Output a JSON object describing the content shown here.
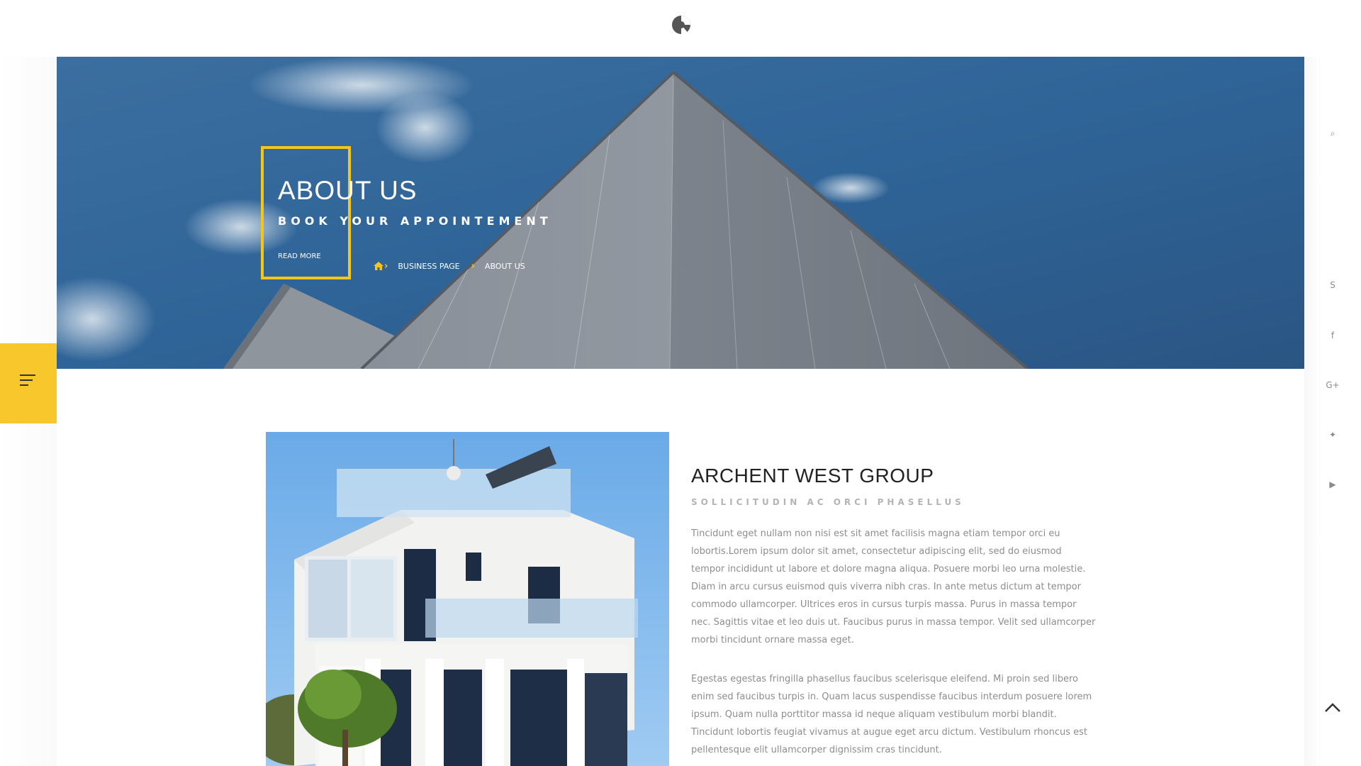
{
  "header": {
    "logo_name": "logo-icon"
  },
  "hero": {
    "title": "ABOUT US",
    "subtitle": "BOOK YOUR APPOINTEMENT",
    "read_more": "READ MORE",
    "breadcrumb": {
      "home_icon": "home-icon",
      "items": [
        "BUSINESS PAGE",
        "ABOUT US"
      ]
    },
    "accent_color": "#f5c518"
  },
  "menu": {
    "icon": "menu-icon",
    "color": "#f7c72c"
  },
  "rail": {
    "icons": [
      "search-icon",
      "skype-icon",
      "facebook-icon",
      "google-plus-icon",
      "twitter-icon",
      "youtube-icon"
    ],
    "glyphs": {
      "search": "⌕",
      "skype": "S",
      "facebook": "f",
      "google_plus": "G+",
      "twitter": "✦",
      "youtube": "▶"
    }
  },
  "content": {
    "title": "ARCHENT WEST GROUP",
    "subtitle": "SOLLICITUDIN AC ORCI PHASELLUS",
    "paragraphs": [
      "Tincidunt eget nullam non nisi est sit amet facilisis magna etiam tempor orci eu lobortis.Lorem ipsum dolor sit amet, consectetur adipiscing elit, sed do eiusmod tempor incididunt ut labore et dolore magna aliqua. Posuere morbi leo urna molestie. Diam in arcu cursus euismod quis viverra nibh cras. In ante metus dictum at tempor commodo ullamcorper. Ultrices eros in cursus turpis massa. Purus in massa tempor nec. Sagittis vitae et leo duis ut. Faucibus purus in massa tempor. Velit sed ullamcorper morbi tincidunt ornare massa eget.",
      "Egestas egestas fringilla phasellus faucibus scelerisque eleifend. Mi proin sed libero enim sed faucibus turpis in. Quam lacus suspendisse faucibus interdum posuere lorem ipsum. Quam nulla porttitor massa id neque aliquam vestibulum morbi blandit. Tincidunt lobortis feugiat vivamus at augue eget arcu dictum. Vestibulum rhoncus est pellentesque elit ullamcorper dignissim cras tincidunt."
    ]
  },
  "back_to_top": "chevron-up-icon"
}
